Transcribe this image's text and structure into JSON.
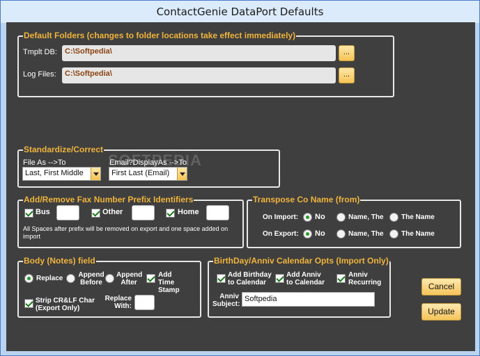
{
  "window": {
    "title": "ContactGenie DataPort Defaults",
    "min": "—",
    "max": "□",
    "close": "✕"
  },
  "folders": {
    "legend": "Default Folders (changes to folder locations take effect immediately)",
    "tmplt_label": "Tmplt DB:",
    "tmplt_value": "C:\\Softpedia\\",
    "log_label": "Log Files:",
    "log_value": "C:\\Softpedia\\",
    "browse": "..."
  },
  "standardize": {
    "legend": "Standardize/Correct",
    "file_as_label": "File As -->To",
    "file_as_value": "Last, First Middle",
    "email_label": "Email?DisplayAs -->To",
    "email_value": "First Last (Email)"
  },
  "watermark": "SOFTPEDIA",
  "fax": {
    "legend": "Add/Remove Fax Number Prefix Identifiers",
    "bus": "Bus",
    "other": "Other",
    "home": "Home",
    "note": "All Spaces after prefix will be removed on export and one space added on import"
  },
  "transpose": {
    "legend": "Transpose Co Name (from)",
    "on_import": "On Import:",
    "on_export": "On Export:",
    "no": "No",
    "name_the": "Name, The",
    "the_name": "The Name"
  },
  "body": {
    "legend": "Body (Notes) field",
    "replace": "Replace",
    "append_before": "Append Before",
    "append_after": "Append After",
    "add_time_stamp": "Add Time Stamp",
    "strip": "Strip CR&LF Char (Export Only)",
    "replace_with": "Replace With:"
  },
  "birthday": {
    "legend": "BirthDay/Anniv Calendar Opts (Import Only)",
    "add_birthday": "Add Birthday to Calendar",
    "add_anniv": "Add Anniv to Calendar",
    "anniv_recurring": "Anniv Recurring",
    "anniv_subject_label": "Anniv Subject:",
    "anniv_subject_value": "Softpedia"
  },
  "buttons": {
    "cancel": "Cancel",
    "update": "Update"
  }
}
